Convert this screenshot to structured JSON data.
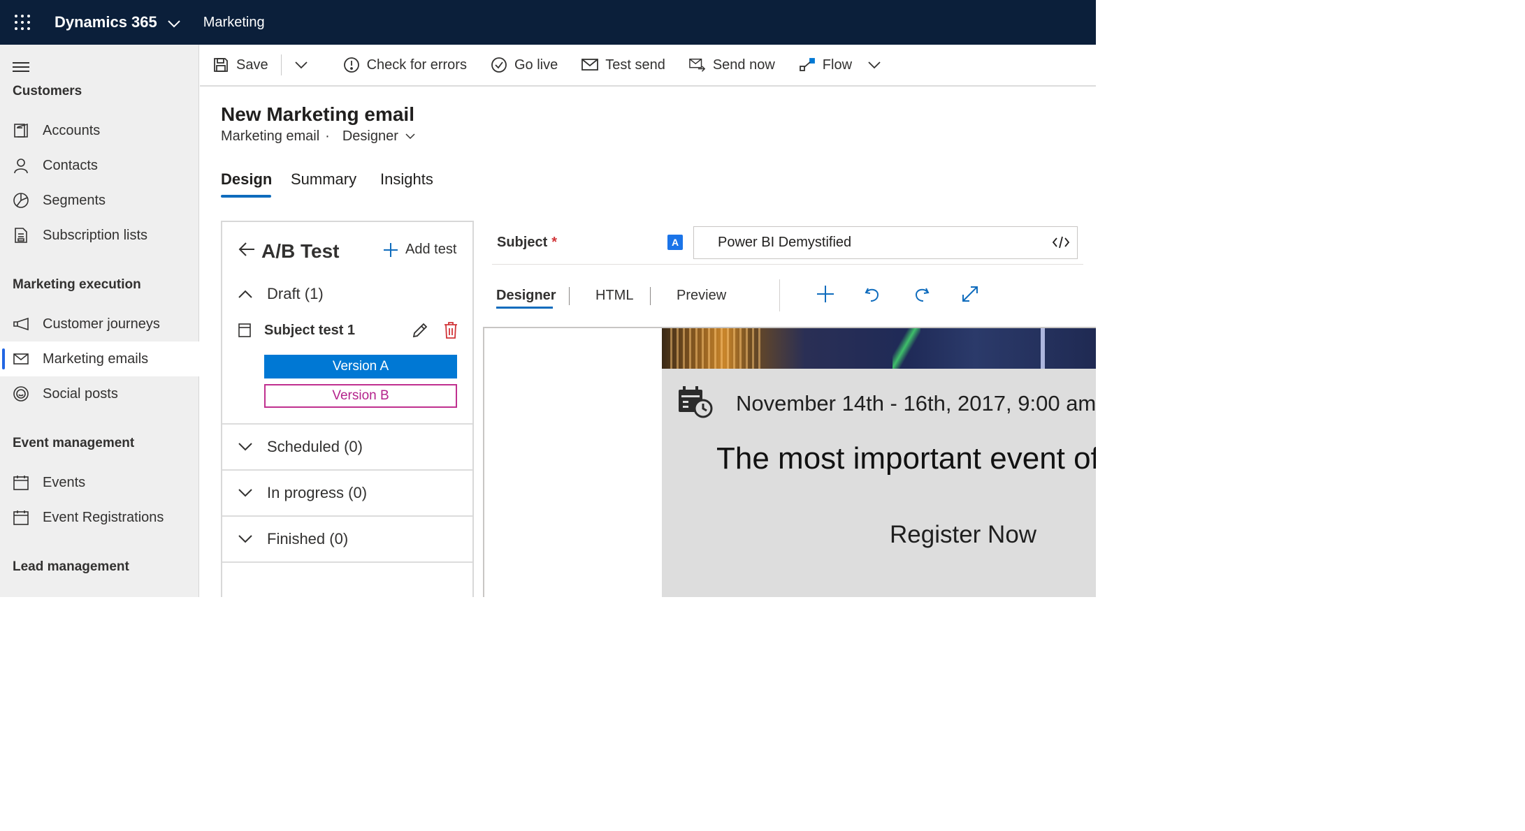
{
  "topbar": {
    "app_name": "Dynamics 365",
    "area": "Marketing",
    "background": "#0b1f3a"
  },
  "sidebar": {
    "groups": [
      {
        "title": "Customers",
        "items": [
          {
            "label": "Accounts",
            "icon": "accounts-icon"
          },
          {
            "label": "Contacts",
            "icon": "contact-icon"
          },
          {
            "label": "Segments",
            "icon": "segments-icon"
          },
          {
            "label": "Subscription lists",
            "icon": "subscription-list-icon"
          }
        ]
      },
      {
        "title": "Marketing execution",
        "items": [
          {
            "label": "Customer journeys",
            "icon": "megaphone-icon"
          },
          {
            "label": "Marketing emails",
            "icon": "mail-icon",
            "active": true
          },
          {
            "label": "Social posts",
            "icon": "smiley-icon"
          }
        ]
      },
      {
        "title": "Event management",
        "items": [
          {
            "label": "Events",
            "icon": "calendar-icon"
          },
          {
            "label": "Event Registrations",
            "icon": "calendar-icon"
          }
        ]
      },
      {
        "title": "Lead management",
        "items": []
      }
    ],
    "active_color": "#2266e3"
  },
  "commandbar": {
    "save": "Save",
    "check_errors": "Check for errors",
    "go_live": "Go live",
    "test_send": "Test send",
    "send_now": "Send now",
    "flow": "Flow"
  },
  "record": {
    "title": "New Marketing email",
    "entity": "Marketing email",
    "separator": "·",
    "form": "Designer"
  },
  "tabs": [
    {
      "label": "Design",
      "active": true
    },
    {
      "label": "Summary"
    },
    {
      "label": "Insights"
    }
  ],
  "ab_test": {
    "title": "A/B Test",
    "add_test": "Add test",
    "sections": [
      {
        "label": "Draft (1)",
        "expanded": true
      },
      {
        "label": "Scheduled (0)"
      },
      {
        "label": "In progress (0)"
      },
      {
        "label": "Finished (0)"
      }
    ],
    "test_name": "Subject test 1",
    "version_a": "Version A",
    "version_b": "Version B",
    "version_a_color": "#0078d4",
    "version_b_color": "#c0308f"
  },
  "subject": {
    "label": "Subject",
    "required_mark": "*",
    "badge": "A",
    "value": "Power BI Demystified"
  },
  "editor": {
    "tabs": [
      {
        "label": "Designer",
        "active": true
      },
      {
        "label": "HTML"
      },
      {
        "label": "Preview"
      }
    ],
    "tools": [
      "add-icon",
      "undo-icon",
      "redo-icon",
      "expand-icon"
    ]
  },
  "email_preview": {
    "date_line": "November 14th - 16th, 2017, 9:00 am",
    "heading": "The most important event of",
    "cta": "Register Now"
  }
}
